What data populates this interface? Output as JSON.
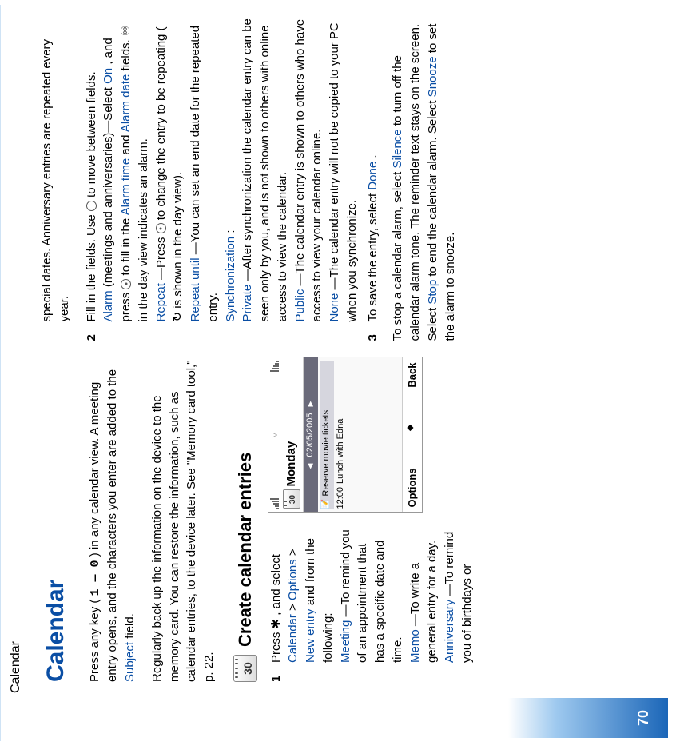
{
  "sidebar": {
    "label": "Calendar",
    "page_number": "70"
  },
  "title": "Calendar",
  "left": {
    "intro_a": "Press any key (",
    "intro_keys": "1 — 0",
    "intro_b": ") in any calendar view. A meeting entry opens, and the characters you enter are added to the ",
    "intro_subject": "Subject",
    "intro_c": " field.",
    "backup": "Regularly back up the information on the device to the memory card. You can restore the information, such as calendar entries, to the device later. See \"Memory card tool,\" p. 22.",
    "h2": "Create calendar entries",
    "cal_icon_num": "30",
    "step1_a": "Press ",
    "step1_b": ", and select ",
    "step1_calendar": "Calendar",
    "step1_gt1": " > ",
    "step1_options": "Options",
    "step1_gt2": " > ",
    "step1_newentry": "New entry",
    "step1_c": " and from the following:",
    "meeting_label": "Meeting",
    "meeting_text": "—To remind you of an appointment that has a specific date and time.",
    "memo_label": "Memo",
    "memo_text": "—To write a general entry for a day.",
    "anniv_label": "Anniversary",
    "anniv_text": "—To remind you of birthdays or",
    "shot": {
      "mini_cal_num": "30",
      "day": "Monday",
      "date": "02/05/2005",
      "row1_icon": "📝",
      "row1_text": "Reserve movie tickets",
      "row2_time": "12:00",
      "row2_text": "Lunch with Edna",
      "soft_left": "Options",
      "soft_right": "Back"
    }
  },
  "right": {
    "special": "special dates. Anniversary entries are repeated every year.",
    "step2_a": "Fill in the fields. Use ",
    "step2_b": " to move between fields.",
    "alarm_label": "Alarm",
    "alarm_a": " (meetings and anniversaries)—Select ",
    "alarm_on": "On",
    "alarm_b": ", and press ",
    "alarm_c": " to fill in the ",
    "alarm_time": "Alarm time",
    "alarm_and": " and ",
    "alarm_date": "Alarm date",
    "alarm_d": " fields. ",
    "alarm_glyph": "♾",
    "alarm_e": " in the day view indicates an alarm.",
    "repeat_label": "Repeat",
    "repeat_a": "—Press ",
    "repeat_b": " to change the entry to be repeating (",
    "repeat_glyph": "↻",
    "repeat_c": " is shown in the day view).",
    "repuntil_label": "Repeat until",
    "repuntil_text": "—You can set an end date for the repeated entry.",
    "sync_label": "Synchronization",
    "sync_colon": ":",
    "private_label": "Private",
    "private_text": "—After synchronization the calendar entry can be seen only by you, and is not shown to others with online access to view the calendar.",
    "public_label": "Public",
    "public_text": "—The calendar entry is shown to others who have access to view your calendar online.",
    "none_label": "None",
    "none_text": "—The calendar entry will not be copied to your PC when you synchronize.",
    "step3_a": "To save the entry, select ",
    "step3_done": "Done",
    "step3_b": ".",
    "stop_a": "To stop a calendar alarm, select ",
    "stop_silence": "Silence",
    "stop_b": " to turn off the calendar alarm tone. The reminder text stays on the screen. Select ",
    "stop_stop": "Stop",
    "stop_c": " to end the calendar alarm. Select ",
    "stop_snooze": "Snooze",
    "stop_d": " to set the alarm to snooze."
  }
}
